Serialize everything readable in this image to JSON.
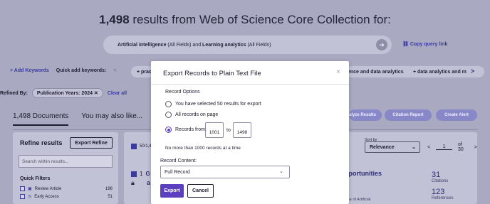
{
  "header": {
    "count": "1,498",
    "text": " results from Web of Science Core Collection for:"
  },
  "query": {
    "term1": "Artificial intelligence",
    "field1": " (All Fields) and ",
    "term2": "Learning analytics",
    "field2": " (All Fields)",
    "copy_link": "Copy query link"
  },
  "keywords": {
    "add_label": "+ Add Keywords",
    "quick_add_label": "Quick add keywords:",
    "prev": "<",
    "next": ">",
    "chip_left": "+ prac",
    "chip_mid": "ence and data analytics",
    "chip_right": "+ data analytics and m"
  },
  "refined": {
    "label": "Refined By:",
    "pill": "Publication Years: 2024 ✕",
    "clear": "Clear all"
  },
  "tabs": {
    "documents": "1,498 Documents",
    "also_like": "You may also like..."
  },
  "actions": {
    "analyze": "alyze Results",
    "citation_report": "Citation Report",
    "create_alert": "Create Alert"
  },
  "refine_panel": {
    "title": "Refine results",
    "export_refine": "Export Refine",
    "search_placeholder": "Search within results...",
    "quick_filters": "Quick Filters",
    "filters": [
      {
        "label": "Review Article",
        "count": "196"
      },
      {
        "label": "Early Access",
        "count": "51"
      }
    ]
  },
  "results": {
    "selected": "50/1,4",
    "sort_label": "Sort by",
    "sort_value": "Relevance",
    "page": "1",
    "page_of": "of 30",
    "r1_num": "1",
    "r1_letter": "G",
    "r1_letter2": "a",
    "r1_title_tail": "pportunities",
    "r1_sub_tail": "Age of Artificial",
    "citations": "31",
    "citations_label": "Citations",
    "references": "123",
    "references_label": "References"
  },
  "modal": {
    "title": "Export Records to Plain Text File",
    "close": "×",
    "record_options": "Record Options",
    "opt_selected": "You have selected 50 results for export",
    "opt_all": "All records on page",
    "opt_range": "Records from:",
    "from": "1001",
    "to_label": "to",
    "to": "1498",
    "limit": "No more than 1000 records at a time",
    "record_content_label": "Record Content:",
    "record_content": "Full Record",
    "export": "Export",
    "cancel": "Cancel"
  },
  "colors": {
    "accent": "#5b3fbf",
    "overlay": "#a9a9c2",
    "link": "#3b3b9e"
  }
}
